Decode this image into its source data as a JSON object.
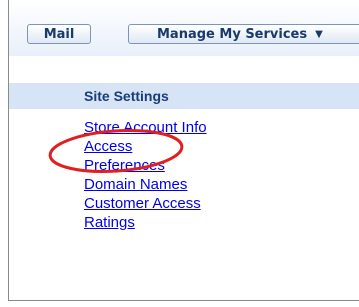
{
  "top_nav": {
    "mail_label": "Mail",
    "manage_label": "Manage My Services",
    "manage_caret": "▼"
  },
  "settings": {
    "title": "Site Settings",
    "links": [
      {
        "label": "Store Account Info"
      },
      {
        "label": "Access"
      },
      {
        "label": "Preferences"
      },
      {
        "label": "Domain Names"
      },
      {
        "label": "Customer Access"
      },
      {
        "label": "Ratings"
      }
    ]
  },
  "colors": {
    "header_band": "#d6e4f5",
    "link": "#0000ee",
    "highlight": "#e02020"
  }
}
